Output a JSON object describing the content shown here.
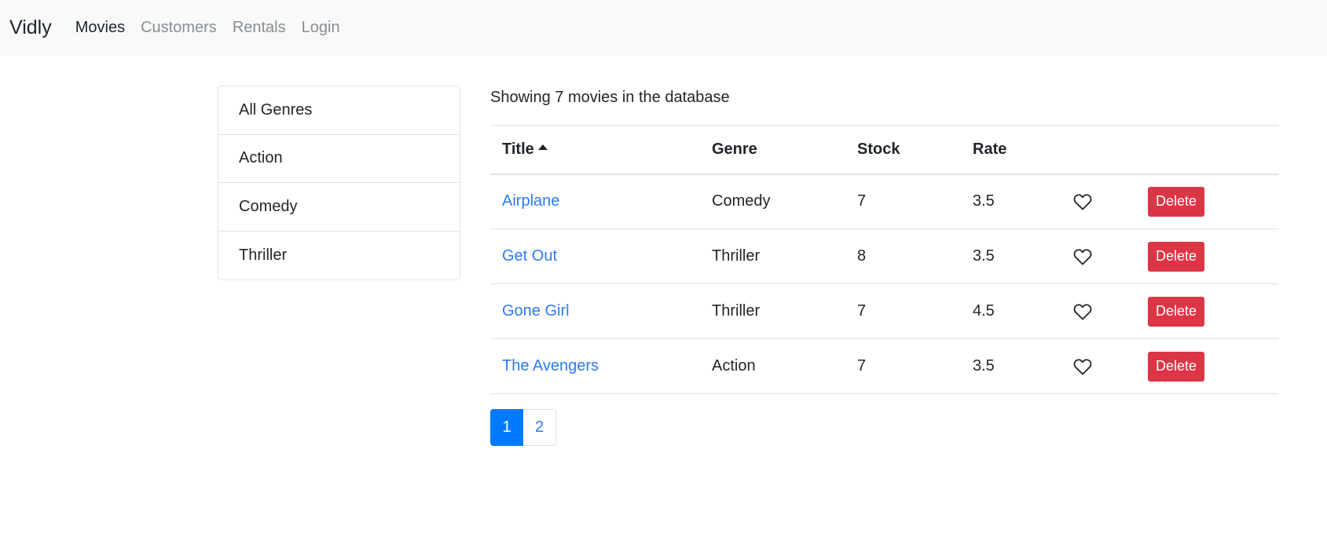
{
  "nav": {
    "brand": "Vidly",
    "links": [
      "Movies",
      "Customers",
      "Rentals",
      "Login"
    ]
  },
  "genres": [
    "All Genres",
    "Action",
    "Comedy",
    "Thriller"
  ],
  "summary": "Showing 7 movies in the database",
  "table": {
    "headers": [
      "Title",
      "Genre",
      "Stock",
      "Rate"
    ],
    "sort_icon": "caret-up-icon",
    "rows": [
      {
        "title": "Airplane",
        "genre": "Comedy",
        "stock": "7",
        "rate": "3.5",
        "delete": "Delete"
      },
      {
        "title": "Get Out",
        "genre": "Thriller",
        "stock": "8",
        "rate": "3.5",
        "delete": "Delete"
      },
      {
        "title": "Gone Girl",
        "genre": "Thriller",
        "stock": "7",
        "rate": "4.5",
        "delete": "Delete"
      },
      {
        "title": "The Avengers",
        "genre": "Action",
        "stock": "7",
        "rate": "3.5",
        "delete": "Delete"
      }
    ]
  },
  "pagination": [
    "1",
    "2"
  ],
  "colors": {
    "primary": "#007bff",
    "link": "#2b7bf0",
    "danger": "#dc3545",
    "navbar_bg": "#f8f9fa"
  }
}
